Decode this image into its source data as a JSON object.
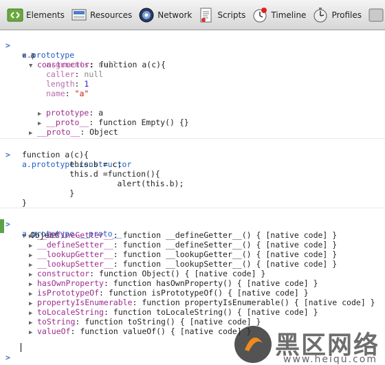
{
  "toolbar": {
    "items": [
      {
        "label": "Elements",
        "icon": "elements-icon"
      },
      {
        "label": "Resources",
        "icon": "resources-icon"
      },
      {
        "label": "Network",
        "icon": "network-icon"
      },
      {
        "label": "Scripts",
        "icon": "scripts-icon"
      },
      {
        "label": "Timeline",
        "icon": "timeline-icon"
      },
      {
        "label": "Profiles",
        "icon": "profiles-icon"
      }
    ]
  },
  "console": {
    "entry1": {
      "command": "a.prototype",
      "root": "a",
      "constructor_key": "constructor",
      "constructor_val": "function a(c){",
      "props": [
        {
          "key": "arguments",
          "val": "null",
          "kind": "null"
        },
        {
          "key": "caller",
          "val": "null",
          "kind": "null"
        },
        {
          "key": "length",
          "val": "1",
          "kind": "num"
        },
        {
          "key": "name",
          "val": "\"a\"",
          "kind": "str"
        }
      ],
      "prototype_key": "prototype",
      "prototype_val": "a",
      "inner_proto_key": "__proto__",
      "inner_proto_val": "function Empty() {}",
      "outer_proto_key": "__proto__",
      "outer_proto_val": "Object"
    },
    "entry2": {
      "command": "a.prototype.constructor",
      "code": [
        "function a(c){",
        "          this.b = c;",
        "          this.d =function(){",
        "                    alert(this.b);",
        "          }",
        "}"
      ]
    },
    "entry3": {
      "command": "a.prototype.__proto__",
      "root": "Object",
      "props": [
        {
          "key": "__defineGetter__",
          "val": "function __defineGetter__() { [native code] }"
        },
        {
          "key": "__defineSetter__",
          "val": "function __defineSetter__() { [native code] }"
        },
        {
          "key": "__lookupGetter__",
          "val": "function __lookupGetter__() { [native code] }"
        },
        {
          "key": "__lookupSetter__",
          "val": "function __lookupSetter__() { [native code] }"
        },
        {
          "key": "constructor",
          "val": "function Object() { [native code] }"
        },
        {
          "key": "hasOwnProperty",
          "val": "function hasOwnProperty() { [native code] }"
        },
        {
          "key": "isPrototypeOf",
          "val": "function isPrototypeOf() { [native code] }"
        },
        {
          "key": "propertyIsEnumerable",
          "val": "function propertyIsEnumerable() { [native code] }"
        },
        {
          "key": "toLocaleString",
          "val": "function toLocaleString() { [native code] }"
        },
        {
          "key": "toString",
          "val": "function toString() { [native code] }"
        },
        {
          "key": "valueOf",
          "val": "function valueOf() { [native code] }"
        }
      ]
    }
  },
  "watermark": {
    "title": "黑区网络",
    "url": "www.heiqu.com"
  }
}
